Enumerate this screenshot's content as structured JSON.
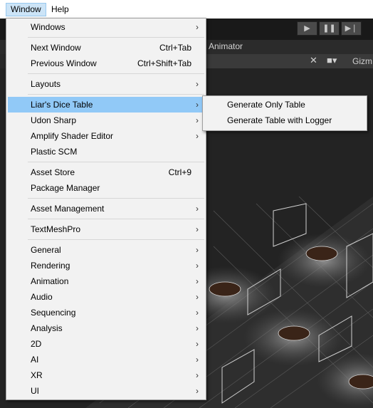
{
  "menubar": {
    "items": [
      {
        "label": "Window",
        "active": true
      },
      {
        "label": "Help",
        "active": false
      }
    ]
  },
  "toolbar": {
    "play_icon": "play-icon",
    "pause_icon": "pause-icon",
    "step_icon": "step-icon"
  },
  "tabs": {
    "animator": "Animator"
  },
  "scene_toolbar": {
    "gizmos_label": "Gizm"
  },
  "window_menu": {
    "items": [
      {
        "label": "Windows",
        "shortcut": "",
        "submenu": true
      },
      {
        "label": "Next Window",
        "shortcut": "Ctrl+Tab",
        "submenu": false
      },
      {
        "label": "Previous Window",
        "shortcut": "Ctrl+Shift+Tab",
        "submenu": false
      },
      {
        "label": "Layouts",
        "shortcut": "",
        "submenu": true
      },
      {
        "label": "Liar's Dice Table",
        "shortcut": "",
        "submenu": true,
        "highlighted": true
      },
      {
        "label": "Udon Sharp",
        "shortcut": "",
        "submenu": true
      },
      {
        "label": "Amplify Shader Editor",
        "shortcut": "",
        "submenu": true
      },
      {
        "label": "Plastic SCM",
        "shortcut": "",
        "submenu": false
      },
      {
        "label": "Asset Store",
        "shortcut": "Ctrl+9",
        "submenu": false
      },
      {
        "label": "Package Manager",
        "shortcut": "",
        "submenu": false
      },
      {
        "label": "Asset Management",
        "shortcut": "",
        "submenu": true
      },
      {
        "label": "TextMeshPro",
        "shortcut": "",
        "submenu": true
      },
      {
        "label": "General",
        "shortcut": "",
        "submenu": true
      },
      {
        "label": "Rendering",
        "shortcut": "",
        "submenu": true
      },
      {
        "label": "Animation",
        "shortcut": "",
        "submenu": true
      },
      {
        "label": "Audio",
        "shortcut": "",
        "submenu": true
      },
      {
        "label": "Sequencing",
        "shortcut": "",
        "submenu": true
      },
      {
        "label": "Analysis",
        "shortcut": "",
        "submenu": true
      },
      {
        "label": "2D",
        "shortcut": "",
        "submenu": true
      },
      {
        "label": "AI",
        "shortcut": "",
        "submenu": true
      },
      {
        "label": "XR",
        "shortcut": "",
        "submenu": true
      },
      {
        "label": "UI",
        "shortcut": "",
        "submenu": true
      }
    ]
  },
  "liars_dice_submenu": {
    "items": [
      {
        "label": "Generate Only Table"
      },
      {
        "label": "Generate Table with Logger"
      }
    ]
  },
  "colors": {
    "highlight": "#91c9f7",
    "menu_bg": "#f2f2f2",
    "menubar_active": "#cce4f7"
  }
}
